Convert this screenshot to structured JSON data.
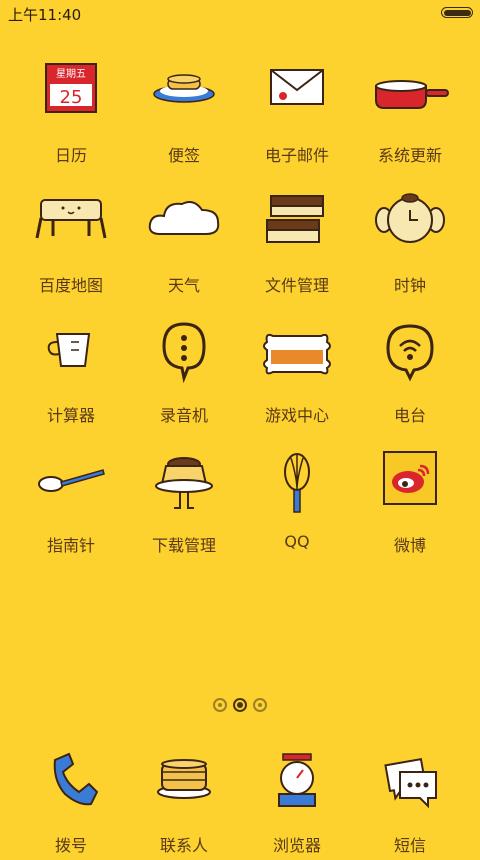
{
  "status_bar": {
    "time": "上午11:40"
  },
  "calendar": {
    "weekday": "星期五",
    "day": "25"
  },
  "apps": [
    {
      "label": "日历"
    },
    {
      "label": "便签"
    },
    {
      "label": "电子邮件"
    },
    {
      "label": "系统更新"
    },
    {
      "label": "百度地图"
    },
    {
      "label": "天气"
    },
    {
      "label": "文件管理"
    },
    {
      "label": "时钟"
    },
    {
      "label": "计算器"
    },
    {
      "label": "录音机"
    },
    {
      "label": "游戏中心"
    },
    {
      "label": "电台"
    },
    {
      "label": "指南针"
    },
    {
      "label": "下载管理"
    },
    {
      "label": "QQ"
    },
    {
      "label": "微博"
    }
  ],
  "dock": [
    {
      "label": "拨号"
    },
    {
      "label": "联系人"
    },
    {
      "label": "浏览器"
    },
    {
      "label": "短信"
    }
  ],
  "page_indicator": {
    "pages": 3,
    "current": 2
  },
  "colors": {
    "background": "#FDD12E",
    "label": "#5a3a16",
    "outline": "#3b2414",
    "accent_red": "#D9262C"
  }
}
